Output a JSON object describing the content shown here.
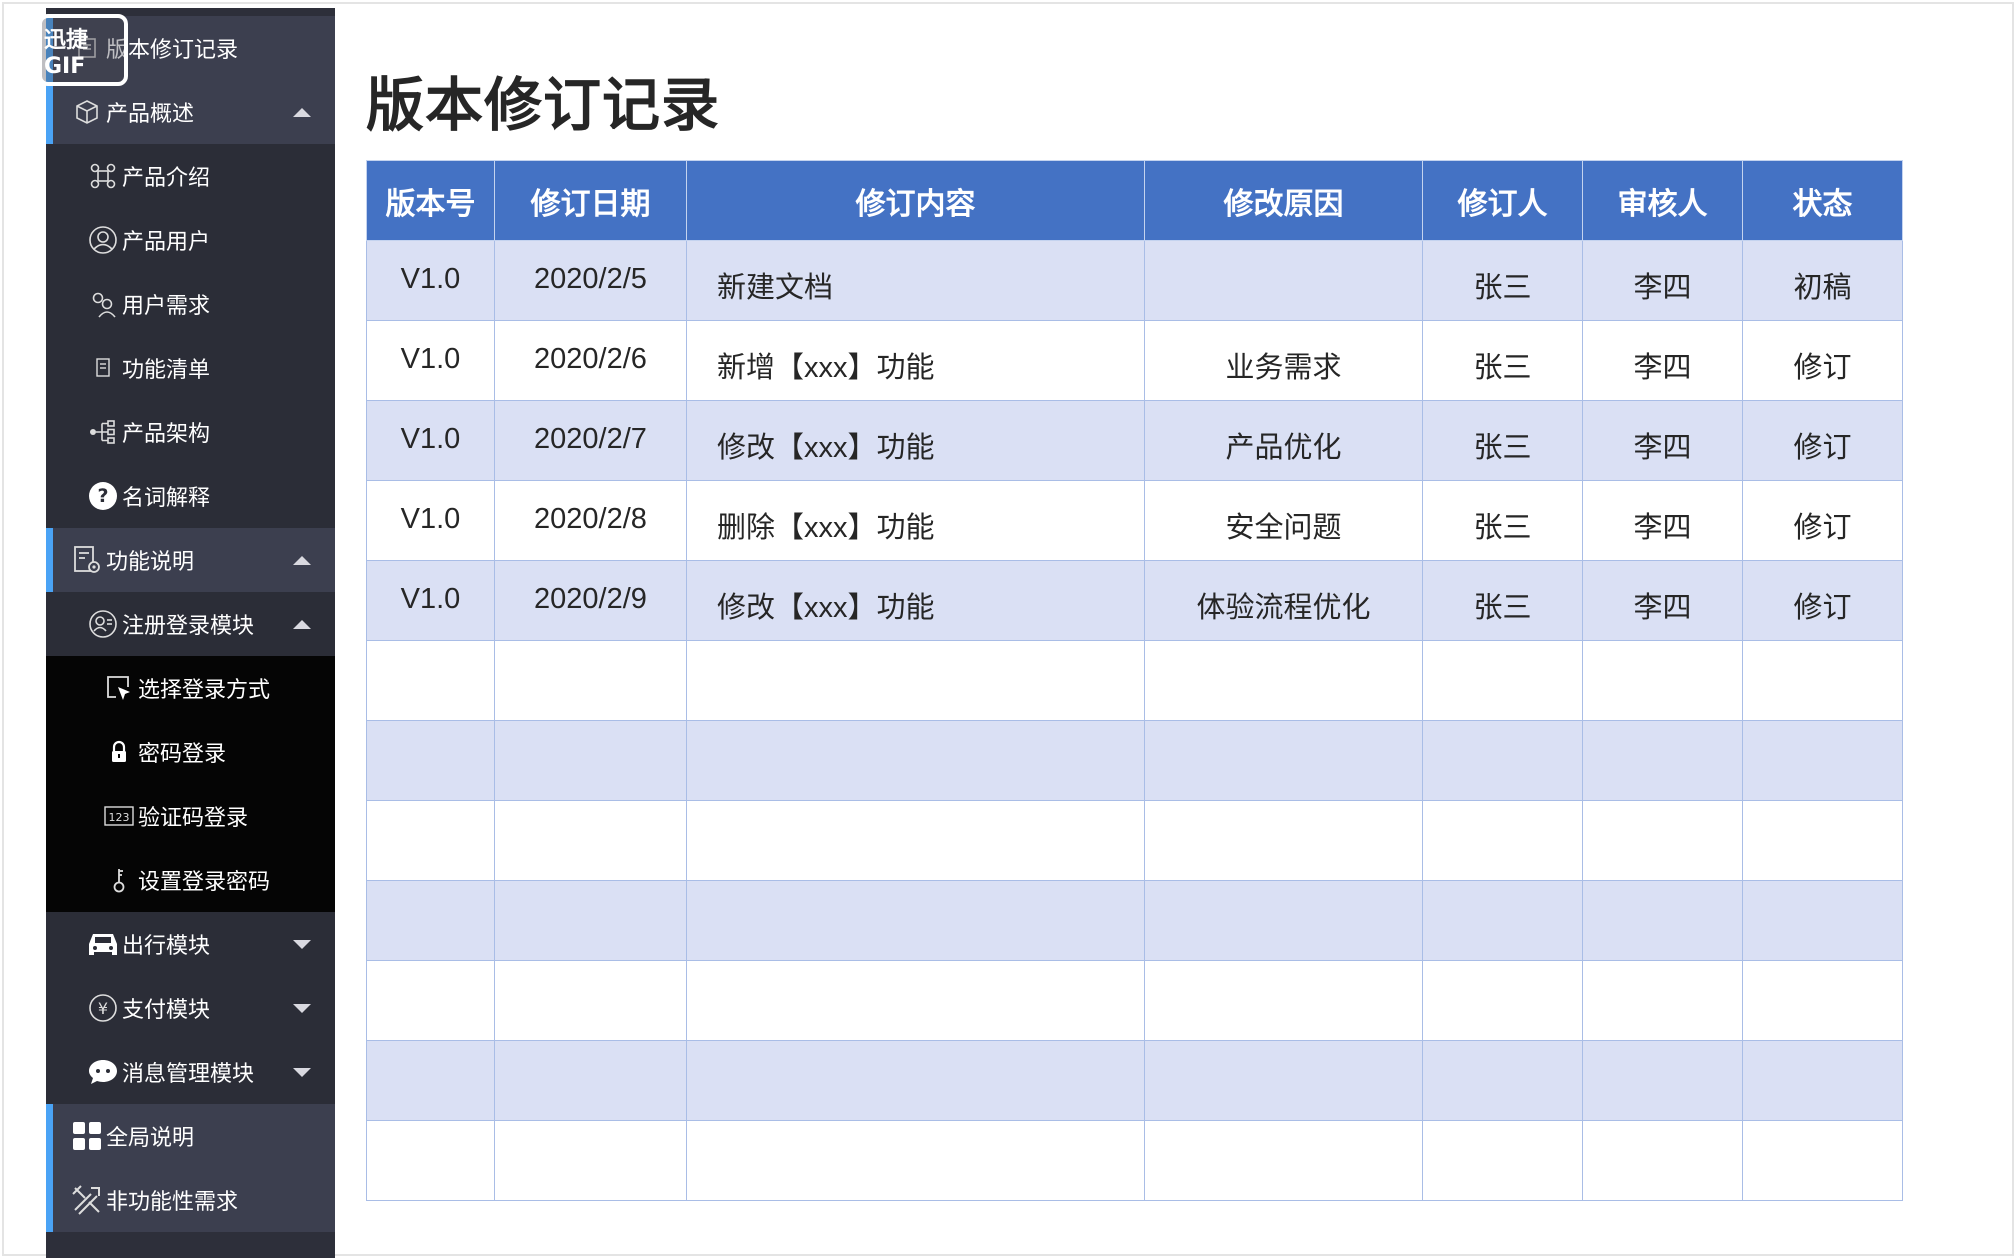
{
  "watermark": "迅捷GIF",
  "sidebar": {
    "items": [
      {
        "label": "版本修订记录",
        "icon": "document-list-icon",
        "level": 1,
        "caret": ""
      },
      {
        "label": "产品概述",
        "icon": "cube-icon",
        "level": 1,
        "caret": "up"
      },
      {
        "label": "产品介绍",
        "icon": "nodes-icon",
        "level": 2,
        "caret": ""
      },
      {
        "label": "产品用户",
        "icon": "user-circle-icon",
        "level": 2,
        "caret": ""
      },
      {
        "label": "用户需求",
        "icon": "users-icon",
        "level": 2,
        "caret": ""
      },
      {
        "label": "功能清单",
        "icon": "checklist-icon",
        "level": 2,
        "caret": ""
      },
      {
        "label": "产品架构",
        "icon": "tree-structure-icon",
        "level": 2,
        "caret": ""
      },
      {
        "label": "名词解释",
        "icon": "question-icon",
        "level": 2,
        "caret": ""
      },
      {
        "label": "功能说明",
        "icon": "doc-gear-icon",
        "level": 1,
        "caret": "up"
      },
      {
        "label": "注册登录模块",
        "icon": "user-badge-icon",
        "level": 2,
        "caret": "up"
      },
      {
        "label": "选择登录方式",
        "icon": "cursor-select-icon",
        "level": 3,
        "caret": ""
      },
      {
        "label": "密码登录",
        "icon": "lock-icon",
        "level": 3,
        "caret": ""
      },
      {
        "label": "验证码登录",
        "icon": "code-123-icon",
        "level": 3,
        "caret": ""
      },
      {
        "label": "设置登录密码",
        "icon": "key-icon",
        "level": 3,
        "caret": ""
      },
      {
        "label": "出行模块",
        "icon": "car-icon",
        "level": 2,
        "caret": "down"
      },
      {
        "label": "支付模块",
        "icon": "yen-icon",
        "level": 2,
        "caret": "down"
      },
      {
        "label": "消息管理模块",
        "icon": "chat-icon",
        "level": 2,
        "caret": "down"
      },
      {
        "label": "全局说明",
        "icon": "grid-icon",
        "level": 1,
        "caret": ""
      },
      {
        "label": "非功能性需求",
        "icon": "tools-icon",
        "level": 1,
        "caret": ""
      }
    ]
  },
  "main": {
    "title": "版本修订记录",
    "table": {
      "headers": [
        "版本号",
        "修订日期",
        "修订内容",
        "修改原因",
        "修订人",
        "审核人",
        "状态"
      ],
      "rows": [
        [
          "V1.0",
          "2020/2/5",
          "新建文档",
          "",
          "张三",
          "李四",
          "初稿"
        ],
        [
          "V1.0",
          "2020/2/6",
          "新增【xxx】功能",
          "业务需求",
          "张三",
          "李四",
          "修订"
        ],
        [
          "V1.0",
          "2020/2/7",
          "修改【xxx】功能",
          "产品优化",
          "张三",
          "李四",
          "修订"
        ],
        [
          "V1.0",
          "2020/2/8",
          "删除【xxx】功能",
          "安全问题",
          "张三",
          "李四",
          "修订"
        ],
        [
          "V1.0",
          "2020/2/9",
          "修改【xxx】功能",
          "体验流程优化",
          "张三",
          "李四",
          "修订"
        ],
        [
          "",
          "",
          "",
          "",
          "",
          "",
          ""
        ],
        [
          "",
          "",
          "",
          "",
          "",
          "",
          ""
        ],
        [
          "",
          "",
          "",
          "",
          "",
          "",
          ""
        ],
        [
          "",
          "",
          "",
          "",
          "",
          "",
          ""
        ],
        [
          "",
          "",
          "",
          "",
          "",
          "",
          ""
        ],
        [
          "",
          "",
          "",
          "",
          "",
          "",
          ""
        ],
        [
          "",
          "",
          "",
          "",
          "",
          "",
          ""
        ]
      ]
    }
  },
  "colors": {
    "sidebar_bg": "#2d2f3a",
    "sidebar_level1_bg": "#3c3f4f",
    "sidebar_level3_bg": "#050505",
    "accent": "#4aa3f5",
    "table_header": "#4472c4",
    "table_band": "#dae0f4",
    "table_border": "#a9bde6"
  }
}
